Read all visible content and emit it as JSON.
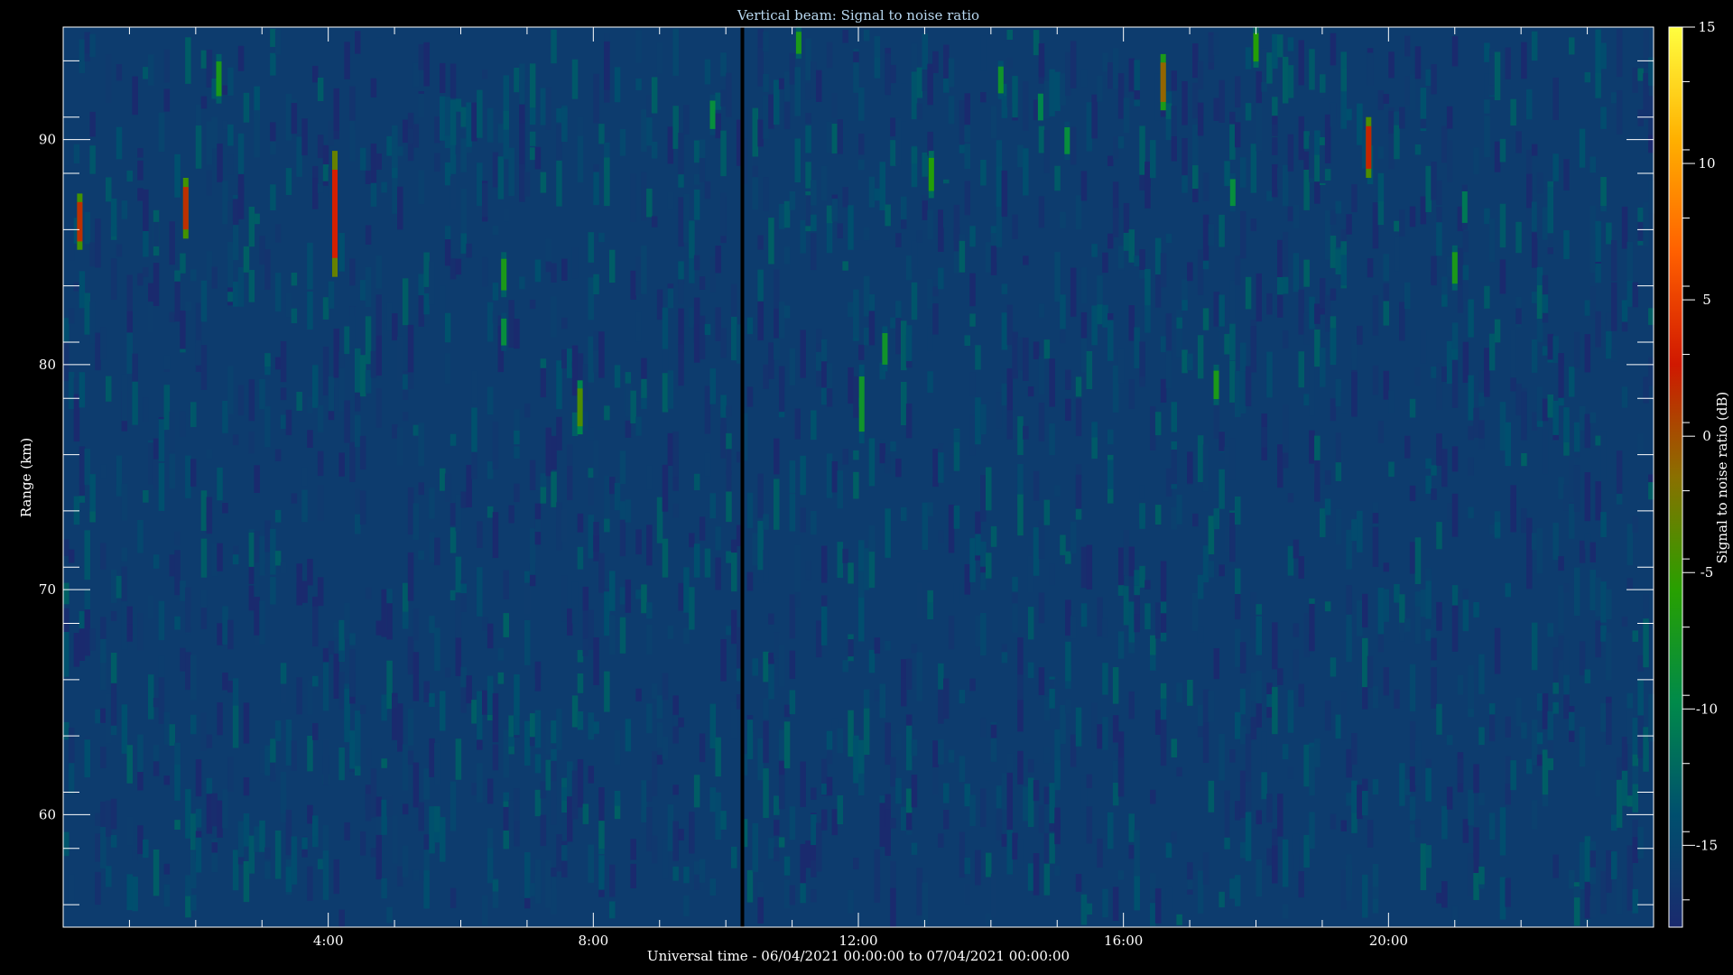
{
  "chart_data": {
    "type": "heatmap",
    "title": "Vertical beam: Signal to noise ratio",
    "xlabel": "Universal time - 06/04/2021 00:00:00 to 07/04/2021 00:00:00",
    "ylabel": "Range (km)",
    "colorbar_label": "Signal to noise ratio (dB)",
    "xlim": [
      0,
      24
    ],
    "ylim": [
      55,
      95
    ],
    "x_tick_hours": [
      4,
      8,
      12,
      16,
      20
    ],
    "x_tick_labels": [
      "4:00",
      "8:00",
      "12:00",
      "16:00",
      "20:00"
    ],
    "y_ticks": [
      60,
      70,
      80,
      90
    ],
    "y_tick_labels": [
      "60",
      "70",
      "80",
      "90"
    ],
    "clim": [
      -18,
      15
    ],
    "colorbar_ticks": [
      15,
      10,
      5,
      0,
      -5,
      -10,
      -15
    ],
    "colorbar_tick_labels": [
      "15",
      "10",
      "5",
      "0",
      "-5",
      "-10",
      "-15"
    ],
    "background_snr_db": -16,
    "data_gap_hour": 10.25,
    "colormap": [
      "#1a2a6e",
      "#004f6e",
      "#008a4a",
      "#28a000",
      "#8a7000",
      "#d01800",
      "#ff6000",
      "#ffb000",
      "#ffff40"
    ],
    "echoes": [
      {
        "t": 0.25,
        "r_top": 87.6,
        "r_bot": 85.1,
        "snr_db": 1.5
      },
      {
        "t": 1.85,
        "r_top": 88.3,
        "r_bot": 85.6,
        "snr_db": 1.5
      },
      {
        "t": 2.35,
        "r_top": 93.8,
        "r_bot": 91.6,
        "snr_db": -7
      },
      {
        "t": 4.1,
        "r_top": 89.5,
        "r_bot": 83.9,
        "snr_db": 3
      },
      {
        "t": 6.65,
        "r_top": 85.0,
        "r_bot": 83.0,
        "snr_db": -7
      },
      {
        "t": 6.65,
        "r_top": 82.3,
        "r_bot": 80.6,
        "snr_db": -9
      },
      {
        "t": 7.8,
        "r_top": 79.3,
        "r_bot": 76.9,
        "snr_db": -4
      },
      {
        "t": 9.8,
        "r_top": 92.0,
        "r_bot": 90.2,
        "snr_db": -9
      },
      {
        "t": 11.1,
        "r_top": 95.0,
        "r_bot": 93.6,
        "snr_db": -7
      },
      {
        "t": 12.05,
        "r_top": 80.0,
        "r_bot": 76.5,
        "snr_db": -8
      },
      {
        "t": 12.4,
        "r_top": 81.7,
        "r_bot": 79.7,
        "snr_db": -8
      },
      {
        "t": 13.1,
        "r_top": 89.5,
        "r_bot": 87.4,
        "snr_db": -6
      },
      {
        "t": 14.15,
        "r_top": 93.5,
        "r_bot": 91.8,
        "snr_db": -8
      },
      {
        "t": 14.75,
        "r_top": 92.3,
        "r_bot": 90.6,
        "snr_db": -10
      },
      {
        "t": 15.15,
        "r_top": 90.8,
        "r_bot": 89.1,
        "snr_db": -9
      },
      {
        "t": 16.6,
        "r_top": 93.8,
        "r_bot": 91.3,
        "snr_db": -1
      },
      {
        "t": 17.4,
        "r_top": 80.0,
        "r_bot": 78.2,
        "snr_db": -7
      },
      {
        "t": 17.65,
        "r_top": 88.5,
        "r_bot": 86.8,
        "snr_db": -9
      },
      {
        "t": 18.0,
        "r_top": 95.0,
        "r_bot": 93.2,
        "snr_db": -6
      },
      {
        "t": 19.7,
        "r_top": 91.0,
        "r_bot": 88.3,
        "snr_db": 2
      },
      {
        "t": 21.0,
        "r_top": 85.3,
        "r_bot": 83.3,
        "snr_db": -7
      },
      {
        "t": 21.15,
        "r_top": 88.0,
        "r_bot": 86.0,
        "snr_db": -11
      }
    ]
  }
}
